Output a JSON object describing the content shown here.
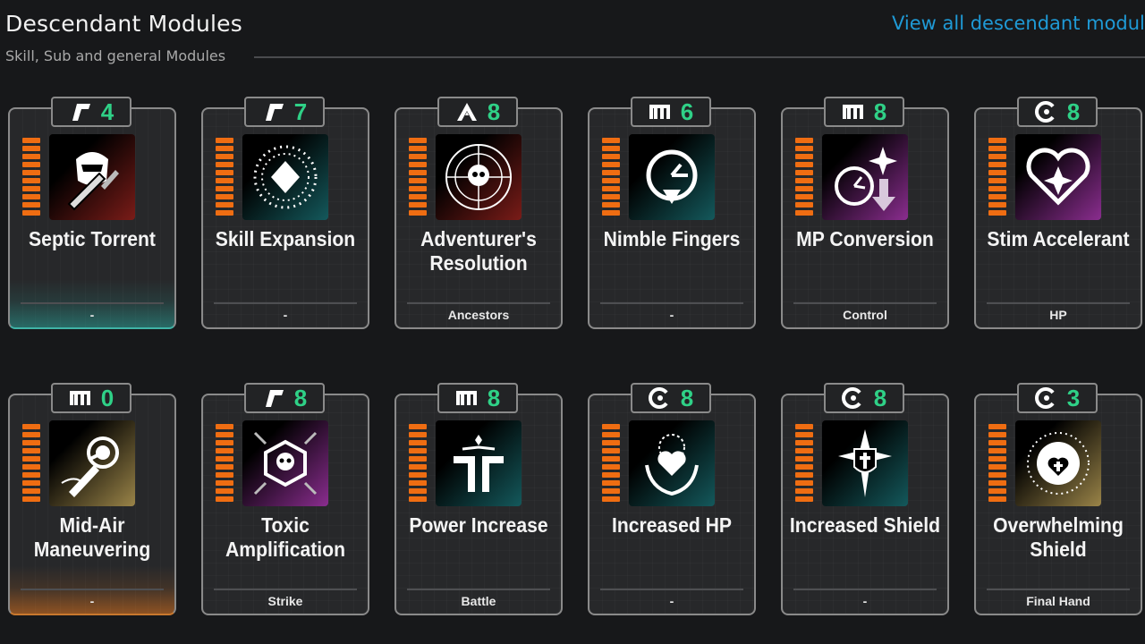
{
  "header": {
    "title": "Descendant Modules",
    "subtitle": "Skill, Sub and general Modules",
    "view_all": "View all descendant modules"
  },
  "colors": {
    "accent_link": "#1f9ad6",
    "capacity_green": "#2fd187",
    "bar_orange": "#ef6d12"
  },
  "modules": [
    {
      "name_lines": [
        "Septic Torrent"
      ],
      "capacity": "4",
      "socket": "rutile-socket-icon",
      "subtype": "-",
      "icon": "septic-torrent-icon",
      "bg": "red"
    },
    {
      "name_lines": [
        "Skill Expansion"
      ],
      "capacity": "7",
      "socket": "rutile-socket-icon",
      "subtype": "-",
      "icon": "skill-expansion-icon",
      "bg": "teal"
    },
    {
      "name_lines": [
        "Adventurer's",
        "Resolution"
      ],
      "capacity": "8",
      "socket": "almandine-socket-icon",
      "subtype": "Ancestors",
      "icon": "adventurers-resolution-icon",
      "bg": "red"
    },
    {
      "name_lines": [
        "Nimble Fingers"
      ],
      "capacity": "6",
      "socket": "malachite-socket-icon",
      "subtype": "-",
      "icon": "nimble-fingers-icon",
      "bg": "teal"
    },
    {
      "name_lines": [
        "MP Conversion"
      ],
      "capacity": "8",
      "socket": "malachite-socket-icon",
      "subtype": "Control",
      "icon": "mp-conversion-icon",
      "bg": "purple"
    },
    {
      "name_lines": [
        "Stim Accelerant"
      ],
      "capacity": "8",
      "socket": "cerulean-socket-icon",
      "subtype": "HP",
      "icon": "stim-accelerant-icon",
      "bg": "purple"
    },
    {
      "name_lines": [
        "Mid-Air",
        "Maneuvering"
      ],
      "capacity": "0",
      "socket": "malachite-socket-icon",
      "subtype": "-",
      "icon": "mid-air-maneuvering-icon",
      "bg": "gold"
    },
    {
      "name_lines": [
        "Toxic",
        "Amplification"
      ],
      "capacity": "8",
      "socket": "rutile-socket-icon",
      "subtype": "Strike",
      "icon": "toxic-amplification-icon",
      "bg": "purple"
    },
    {
      "name_lines": [
        "Power Increase"
      ],
      "capacity": "8",
      "socket": "malachite-socket-icon",
      "subtype": "Battle",
      "icon": "power-increase-icon",
      "bg": "teal"
    },
    {
      "name_lines": [
        "Increased HP"
      ],
      "capacity": "8",
      "socket": "cerulean-socket-icon",
      "subtype": "-",
      "icon": "increased-hp-icon",
      "bg": "teal"
    },
    {
      "name_lines": [
        "Increased Shield"
      ],
      "capacity": "8",
      "socket": "cerulean-socket-icon",
      "subtype": "-",
      "icon": "increased-shield-icon",
      "bg": "teal"
    },
    {
      "name_lines": [
        "Overwhelming",
        "Shield"
      ],
      "capacity": "3",
      "socket": "cerulean-socket-icon",
      "subtype": "Final Hand",
      "icon": "overwhelming-shield-icon",
      "bg": "gold"
    }
  ]
}
